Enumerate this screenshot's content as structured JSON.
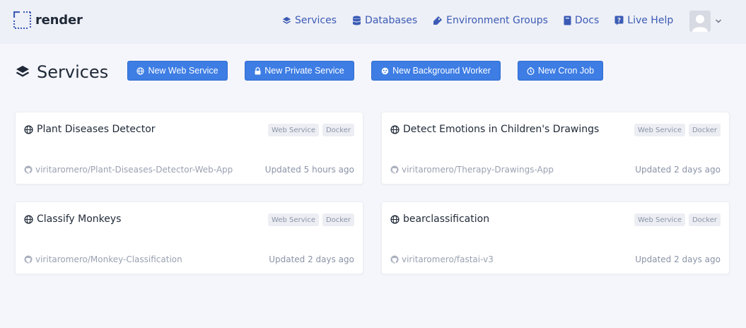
{
  "header": {
    "brand": "render",
    "nav": [
      {
        "label": "Services",
        "icon": "layers-icon"
      },
      {
        "label": "Databases",
        "icon": "database-icon"
      },
      {
        "label": "Environment Groups",
        "icon": "tag-icon"
      },
      {
        "label": "Docs",
        "icon": "book-icon"
      },
      {
        "label": "Live Help",
        "icon": "help-icon"
      }
    ]
  },
  "page": {
    "title": "Services",
    "actions": [
      {
        "label": "New Web Service",
        "icon": "globe-icon"
      },
      {
        "label": "New Private Service",
        "icon": "lock-icon"
      },
      {
        "label": "New Background Worker",
        "icon": "worker-icon"
      },
      {
        "label": "New Cron Job",
        "icon": "clock-icon"
      }
    ]
  },
  "services": [
    {
      "name": "Plant Diseases Detector",
      "type": "Web Service",
      "env": "Docker",
      "repo": "viritaromero/Plant-Diseases-Detector-Web-App",
      "updated": "Updated 5 hours ago"
    },
    {
      "name": "Detect Emotions in Children's Drawings",
      "type": "Web Service",
      "env": "Docker",
      "repo": "viritaromero/Therapy-Drawings-App",
      "updated": "Updated 2 days ago"
    },
    {
      "name": "Classify Monkeys",
      "type": "Web Service",
      "env": "Docker",
      "repo": "viritaromero/Monkey-Classification",
      "updated": "Updated 2 days ago"
    },
    {
      "name": "bearclassification",
      "type": "Web Service",
      "env": "Docker",
      "repo": "viritaromero/fastai-v3",
      "updated": "Updated 2 days ago"
    }
  ],
  "colors": {
    "accent": "#3d7de4",
    "nav": "#3b5bb5",
    "background": "#f5f6fb"
  }
}
